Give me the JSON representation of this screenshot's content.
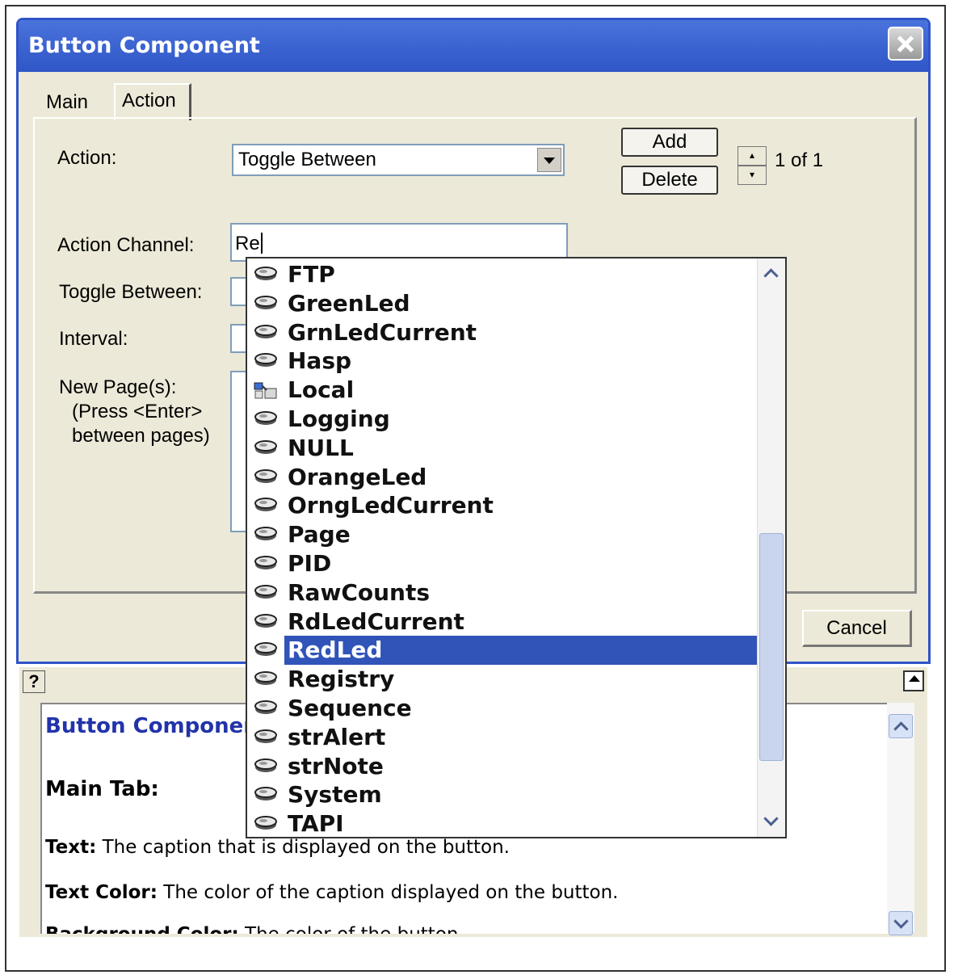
{
  "dialog": {
    "title": "Button Component",
    "tabs": [
      "Main",
      "Action"
    ],
    "action_label": "Action:",
    "action_value": "Toggle Between",
    "add_label": "Add",
    "delete_label": "Delete",
    "counter": "1 of 1",
    "channel_label": "Action Channel:",
    "channel_value": "Re",
    "toggle_label": "Toggle Between:",
    "interval_label": "Interval:",
    "newpage_label_1": "New Page(s):",
    "newpage_label_2": "(Press <Enter>",
    "newpage_label_3": "between pages)",
    "cancel_label": "Cancel"
  },
  "help": {
    "q": "?",
    "title": "Button Component",
    "main_tab": "Main Tab:",
    "p1_bold": "Text:",
    "p1": " The caption that is displayed on the button.",
    "p2_bold": "Text Color:",
    "p2": " The color of the caption displayed on the button.",
    "p3_bold": "Background Color:",
    "p3": " The color of the button."
  },
  "dropdown": {
    "selected": "RedLed",
    "items": [
      {
        "label": "FTP",
        "icon": "channel-icon"
      },
      {
        "label": "GreenLed",
        "icon": "channel-icon"
      },
      {
        "label": "GrnLedCurrent",
        "icon": "channel-icon"
      },
      {
        "label": "Hasp",
        "icon": "channel-icon"
      },
      {
        "label": "Local",
        "icon": "local-channel-icon"
      },
      {
        "label": "Logging",
        "icon": "channel-icon"
      },
      {
        "label": "NULL",
        "icon": "channel-icon"
      },
      {
        "label": "OrangeLed",
        "icon": "channel-icon"
      },
      {
        "label": "OrngLedCurrent",
        "icon": "channel-icon"
      },
      {
        "label": "Page",
        "icon": "channel-icon"
      },
      {
        "label": "PID",
        "icon": "channel-icon"
      },
      {
        "label": "RawCounts",
        "icon": "channel-icon"
      },
      {
        "label": "RdLedCurrent",
        "icon": "channel-icon"
      },
      {
        "label": "RedLed",
        "icon": "channel-icon"
      },
      {
        "label": "Registry",
        "icon": "channel-icon"
      },
      {
        "label": "Sequence",
        "icon": "channel-icon"
      },
      {
        "label": "strAlert",
        "icon": "channel-icon"
      },
      {
        "label": "strNote",
        "icon": "channel-icon"
      },
      {
        "label": "System",
        "icon": "channel-icon"
      },
      {
        "label": "TAPI",
        "icon": "channel-icon"
      }
    ]
  },
  "colors": {
    "titlebar": "#2f56c6",
    "selection": "#3054b8",
    "help_title": "#2233aa"
  }
}
